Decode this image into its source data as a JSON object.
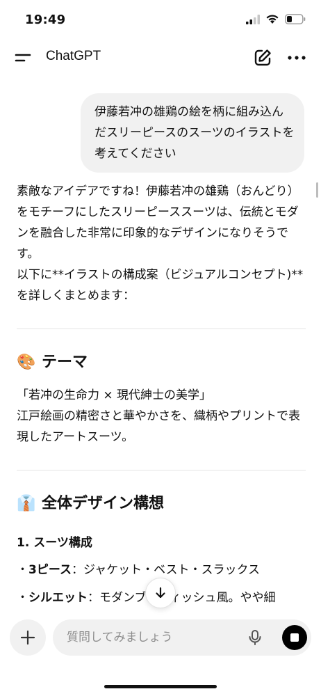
{
  "status": {
    "time": "19:49",
    "icons": [
      "cellular-signal-icon",
      "wifi-icon",
      "battery-icon"
    ]
  },
  "header": {
    "title": "ChatGPT",
    "icons": [
      "menu-icon",
      "new-chat-edit-icon",
      "more-dots-icon"
    ]
  },
  "user_message": "伊藤若冲の雄鶏の絵を柄に組み込んだスリーピースのスーツのイラストを考えてください",
  "assistant": {
    "intro_line1": "素敵なアイデアですね！伊藤若冲の雄鶏（おんどり）をモチーフにしたスリーピーススーツは、伝統とモダンを融合した非常に印象的なデザインになりそうです。",
    "intro_line2": "以下に**イラストの構成案（ビジュアルコンセプト)**を詳しくまとめます：",
    "theme_emoji": "🎨",
    "theme_heading": "テーマ",
    "theme_quote": "「若冲の生命力 × 現代紳士の美学」",
    "theme_text": "江戸絵画の精密さと華やかさを、織柄やプリントで表現したアートスーツ。",
    "design_emoji": "👔",
    "design_heading": "全体デザイン構想",
    "suit_heading": "1. スーツ構成",
    "bullet1_label": "3ピース",
    "bullet1_text": "：ジャケット・ベスト・スラックス",
    "bullet2_label": "シルエット",
    "bullet2_text": "：モダンブリティッシュ風。やや細"
  },
  "composer": {
    "placeholder": "質問してみましょう"
  }
}
